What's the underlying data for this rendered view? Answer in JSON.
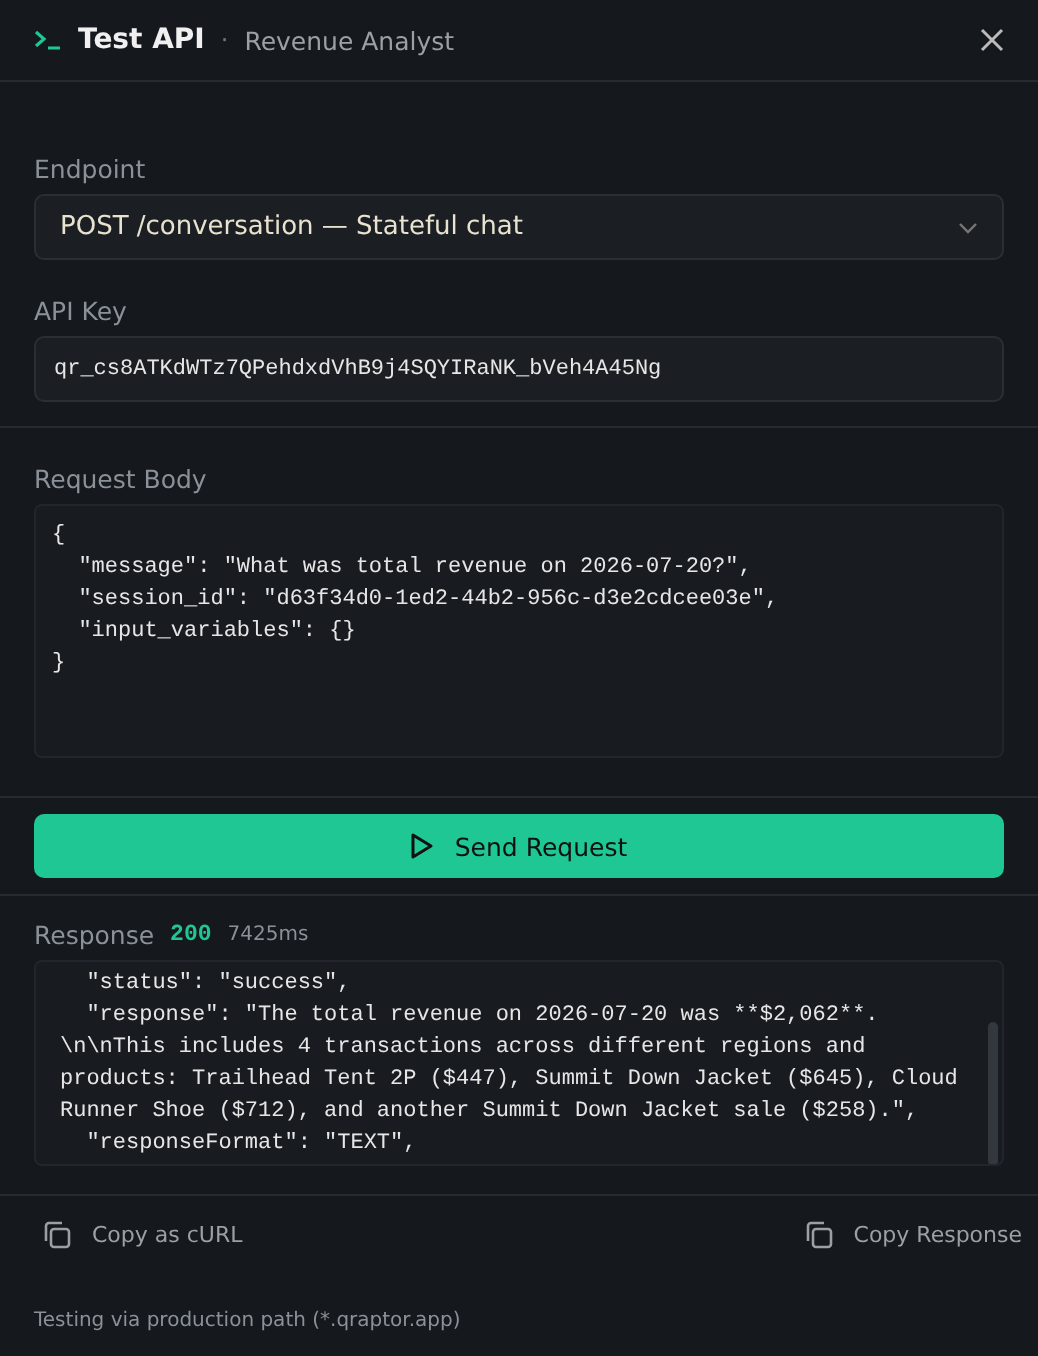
{
  "header": {
    "title": "Test API",
    "separator": "·",
    "subtitle": "Revenue Analyst"
  },
  "endpoint": {
    "label": "Endpoint",
    "value": "POST /conversation — Stateful chat"
  },
  "api_key": {
    "label": "API Key",
    "value": "qr_cs8ATKdWTz7QPehdxdVhB9j4SQYIRaNK_bVeh4A45Ng"
  },
  "request_body": {
    "label": "Request Body",
    "lines": [
      "{",
      "  \"message\": \"What was total revenue on 2026-07-20?\",",
      "  \"session_id\": \"d63f34d0-1ed2-44b2-956c-d3e2cdcee03e\",",
      "  \"input_variables\": {}",
      "}"
    ]
  },
  "send_button": {
    "label": "Send Request"
  },
  "response": {
    "label": "Response",
    "status": "200",
    "time": "7425ms",
    "lines": [
      "  \"status\": \"success\",",
      "  \"response\": \"The total revenue on 2026-07-20 was **$2,062**.",
      "\\n\\nThis includes 4 transactions across different regions and",
      "products: Trailhead Tent 2P ($447), Summit Down Jacket ($645), Cloud",
      "Runner Shoe ($712), and another Summit Down Jacket sale ($258).\",",
      "  \"responseFormat\": \"TEXT\","
    ]
  },
  "actions": [
    {
      "label": "Copy as cURL"
    },
    {
      "label": "Copy Response"
    }
  ],
  "footer": "Testing via production path (*.qraptor.app)"
}
